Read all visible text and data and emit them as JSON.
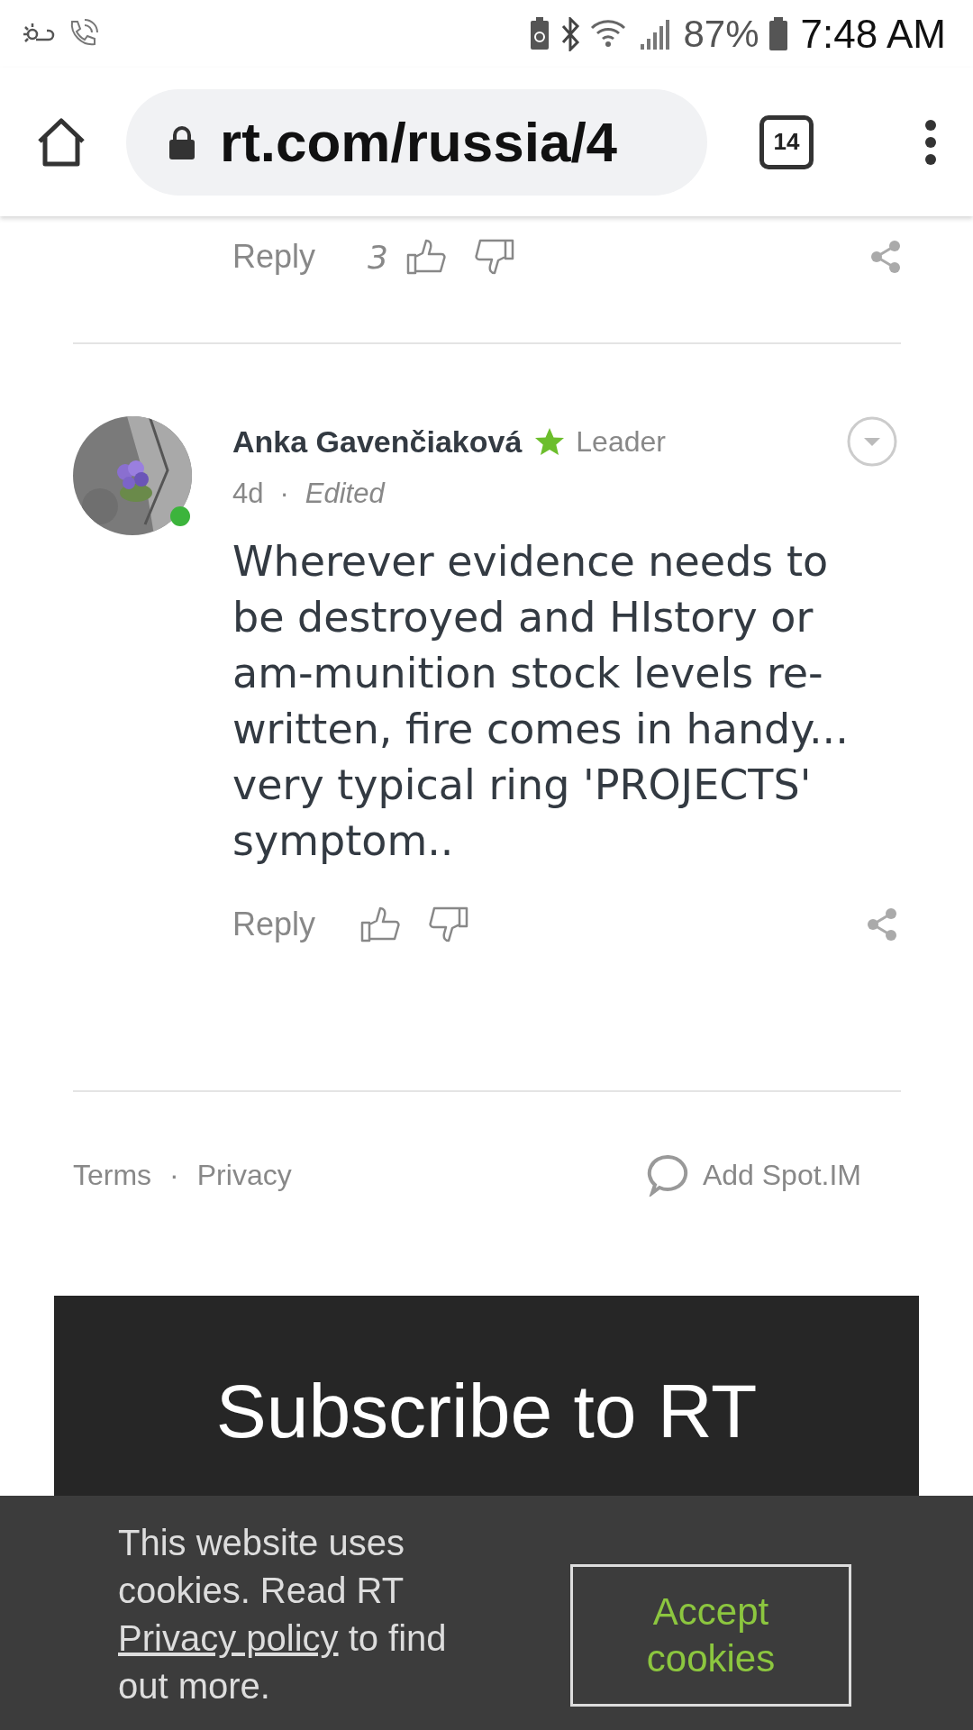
{
  "status_bar": {
    "battery": "87%",
    "time": "7:48 AM"
  },
  "browser": {
    "url": "rt.com/russia/4",
    "tab_count": "14"
  },
  "previous_comment": {
    "reply": "Reply",
    "likes": "3"
  },
  "comment": {
    "author": "Anka Gavenčiaková",
    "badge": "Leader",
    "age": "4d",
    "separator": "·",
    "edited": "Edited",
    "online": true,
    "body": "Wherever evidence needs to be destroyed and HIstory or am-munition stock levels re-written, fire comes in handy... very typical ring 'PROJECTS' symptom..",
    "reply": "Reply"
  },
  "footer": {
    "terms": "Terms",
    "separator": "·",
    "privacy": "Privacy",
    "add": "Add Spot.IM"
  },
  "subscribe": {
    "title": "Subscribe to RT"
  },
  "cookie_banner": {
    "text_before": "This website uses cookies. Read RT ",
    "link": "Privacy policy",
    "text_after": " to find out more.",
    "button": "Accept cookies"
  }
}
